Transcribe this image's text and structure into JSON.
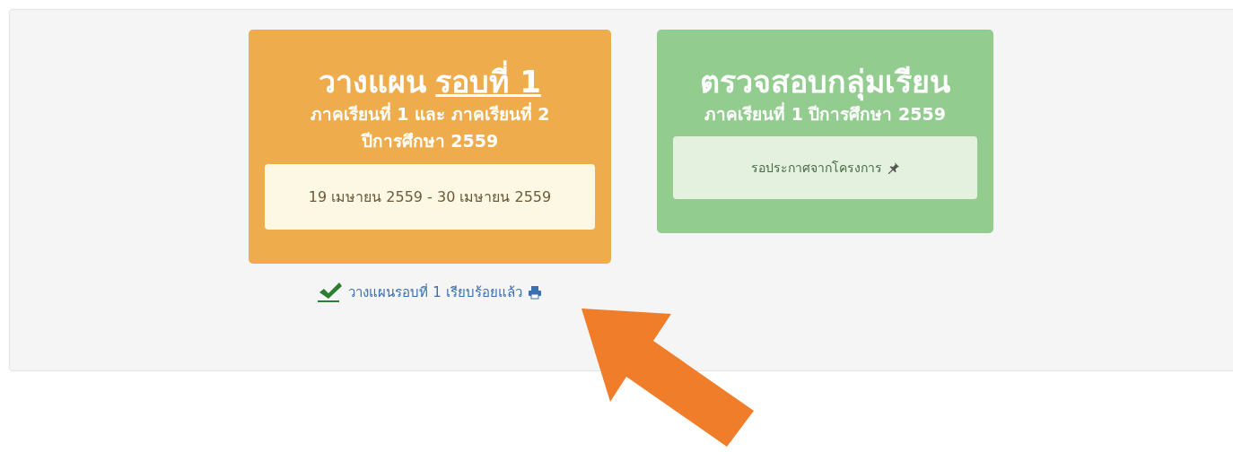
{
  "cards": [
    {
      "kind": "plan",
      "color": "#eeac4c",
      "title": "วางแผน",
      "title_underlined": "รอบที่ 1",
      "lines": [
        "ภาคเรียนที่ 1 และ ภาคเรียนที่ 2",
        "ปีการศึกษา 2559"
      ],
      "box_text": "19 เมษายน 2559 - 30 เมษายน 2559"
    },
    {
      "kind": "notice",
      "color": "#92cd8f",
      "title": "ตรวจสอบกลุ่มเรียน",
      "lines": [
        "ภาคเรียนที่ 1 ปีการศึกษา 2559"
      ],
      "box_text": "รอประกาศจากโครงการ"
    }
  ],
  "status_link": {
    "checked": true,
    "label": "วางแผนรอบที่ 1 เรียบร้อยแล้ว"
  }
}
